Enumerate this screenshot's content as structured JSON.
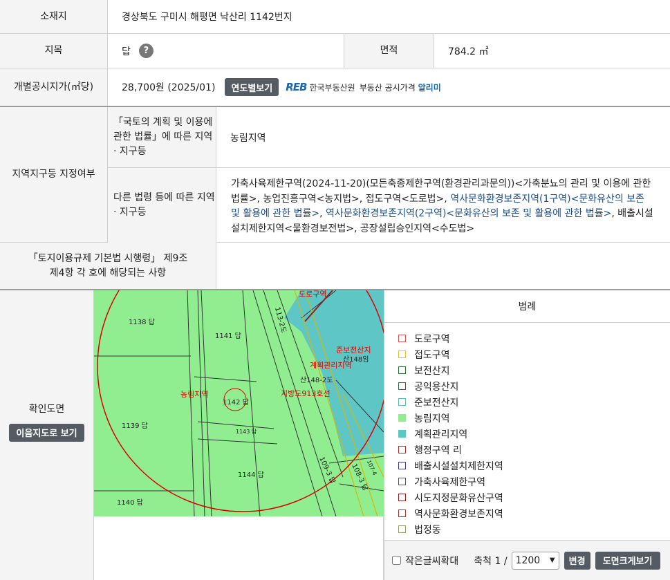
{
  "location": {
    "label": "소재지",
    "value": "경상북도 구미시 해평면 낙산리 1142번지"
  },
  "jimok": {
    "label": "지목",
    "value": "답"
  },
  "area": {
    "label": "면적",
    "value": "784.2 ㎡"
  },
  "price": {
    "label": "개별공시지가(㎡당)",
    "value": "28,700원 (2025/01)",
    "button": "연도별보기",
    "reb_logo": "REB",
    "reb_name": "한국부동산원",
    "reb_service": "부동산 공시가격",
    "reb_service_highlight": "알리미"
  },
  "zoning": {
    "label": "지역지구등 지정여부",
    "national_label": "「국토의 계획 및 이용에 관한 법률」에 따른 지역 · 지구등",
    "national_value": "농림지역",
    "other_label": "다른 법령 등에 따른 지역 · 지구등",
    "other_text_1": "가축사육제한구역(2024-11-20)(모든축종제한구역(환경관리과문의))<가축분뇨의 관리 및 이용에 관한 법률>, 농업진흥구역<농지법>, 접도구역<도로법>, ",
    "other_link_1": "역사문화환경보존지역(1구역)<문화유산의 보존 및 활용에 관한 법률>",
    "other_text_2": ", ",
    "other_link_2": "역사문화환경보존지역(2구역)<문화유산의 보존 및 활용에 관한 법률>",
    "other_text_3": ", 배출시설설치제한지역<물환경보전법>, 공장설립승인지역<수도법>"
  },
  "regulation": {
    "label": "「토지이용규제 기본법 시행령」 제9조 제4항 각 호에 해당되는 사항",
    "value": ""
  },
  "map_section": {
    "label": "확인도면",
    "button": "이음지도로 보기",
    "parcels": [
      "1138 답",
      "1141 답",
      "1139 답",
      "1142 답",
      "1143 답",
      "1144 답",
      "1140 답",
      "산148임",
      "산148-2도",
      "113-2도",
      "109-3 답",
      "108-3 답",
      "107-4"
    ],
    "zone_labels": [
      "준보전산지",
      "계획관리지역",
      "농림지역",
      "지방도913호선",
      "도로구역"
    ]
  },
  "legend": {
    "title": "범례",
    "items": [
      {
        "label": "도로구역",
        "color": "#d9534f"
      },
      {
        "label": "접도구역",
        "color": "#e6c229"
      },
      {
        "label": "보전산지",
        "color": "#2e6b3a"
      },
      {
        "label": "공익용산지",
        "color": "#2e6b3a"
      },
      {
        "label": "준보전산지",
        "color": "#5fb8a8"
      },
      {
        "label": "농림지역",
        "color": "#90ee90",
        "fill": true
      },
      {
        "label": "계획관리지역",
        "color": "#5fc6c6",
        "fill": true
      },
      {
        "label": "행정구역 리",
        "color": "#b03030"
      },
      {
        "label": "배출시설설치제한지역",
        "color": "#3a3a8c"
      },
      {
        "label": "가축사육제한구역",
        "color": "#555555"
      },
      {
        "label": "시도지정문화유산구역",
        "color": "#8b2020"
      },
      {
        "label": "역사문화환경보존지역",
        "color": "#a03a2a"
      },
      {
        "label": "법정동",
        "color": "#9a9a6a"
      }
    ]
  },
  "controls": {
    "small_text_label": "작은글씨확대",
    "scale_label": "축척 1 /",
    "scale_value": "1200",
    "change_button": "변경",
    "enlarge_button": "도면크게보기"
  }
}
